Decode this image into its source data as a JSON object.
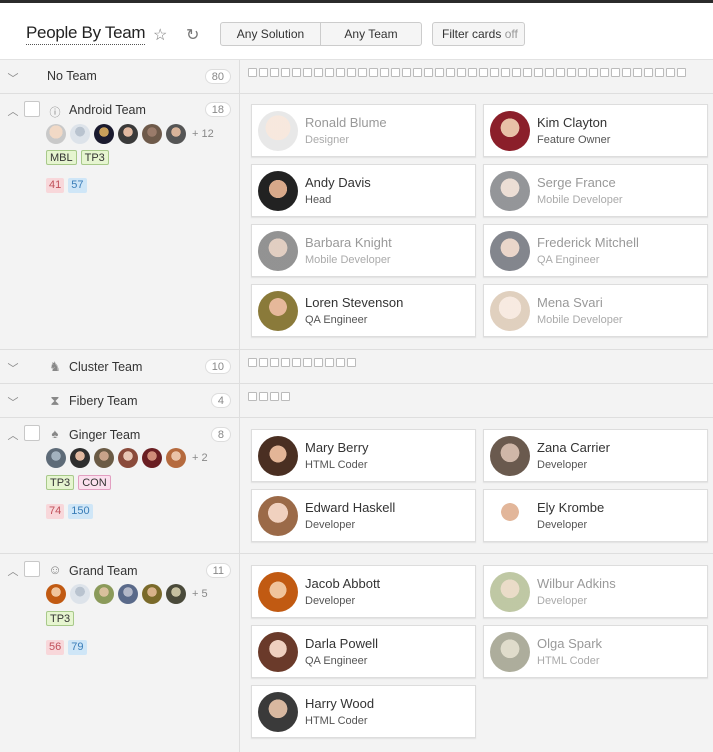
{
  "header": {
    "title": "People By Team",
    "solution_filter": "Any Solution",
    "team_filter": "Any Team",
    "filter_cards_label": "Filter cards",
    "filter_cards_state": "off"
  },
  "rows": {
    "no_team": {
      "name": "No Team",
      "count": "80"
    },
    "android": {
      "name": "Android Team",
      "count": "18",
      "more": "+ 12",
      "tags": [
        "MBL",
        "TP3"
      ],
      "nums": [
        "41",
        "57"
      ],
      "cards": [
        {
          "name": "Ronald Blume",
          "role": "Designer"
        },
        {
          "name": "Kim Clayton",
          "role": "Feature Owner"
        },
        {
          "name": "Andy Davis",
          "role": "Head"
        },
        {
          "name": "Serge France",
          "role": "Mobile Developer"
        },
        {
          "name": "Barbara Knight",
          "role": "Mobile Developer"
        },
        {
          "name": "Frederick Mitchell",
          "role": "QA Engineer"
        },
        {
          "name": "Loren Stevenson",
          "role": "QA Engineer"
        },
        {
          "name": "Mena Svari",
          "role": "Mobile Developer"
        }
      ]
    },
    "cluster": {
      "name": "Cluster Team",
      "count": "10"
    },
    "fibery": {
      "name": "Fibery Team",
      "count": "4"
    },
    "ginger": {
      "name": "Ginger Team",
      "count": "8",
      "more": "+ 2",
      "tags": [
        "TP3",
        "CON"
      ],
      "nums": [
        "74",
        "150"
      ],
      "cards": [
        {
          "name": "Mary Berry",
          "role": "HTML Coder"
        },
        {
          "name": "Zana Carrier",
          "role": "Developer"
        },
        {
          "name": "Edward Haskell",
          "role": "Developer"
        },
        {
          "name": "Ely Krombe",
          "role": "Developer"
        }
      ]
    },
    "grand": {
      "name": "Grand Team",
      "count": "11",
      "more": "+ 5",
      "tags": [
        "TP3"
      ],
      "nums": [
        "56",
        "79"
      ],
      "cards": [
        {
          "name": "Jacob Abbott",
          "role": "Developer"
        },
        {
          "name": "Wilbur Adkins",
          "role": "Developer"
        },
        {
          "name": "Darla Powell",
          "role": "QA Engineer"
        },
        {
          "name": "Olga Spark",
          "role": "HTML Coder"
        },
        {
          "name": "Harry Wood",
          "role": "HTML Coder"
        }
      ]
    }
  },
  "icons": {
    "star": "star-icon",
    "refresh": "refresh-icon",
    "chevron_down": "chevron-down-icon",
    "chevron_up": "chevron-up-icon",
    "android_team": "android-icon",
    "cluster_team": "cluster-icon",
    "fibery_team": "fibery-icon",
    "ginger_team": "spade-icon",
    "grand_team": "smiley-icon"
  },
  "colors": {
    "tag_green": "#e6f5d0",
    "tag_pink": "#fbe0ee",
    "num_red": "#f8d7da",
    "num_blue": "#cfe6f7"
  }
}
